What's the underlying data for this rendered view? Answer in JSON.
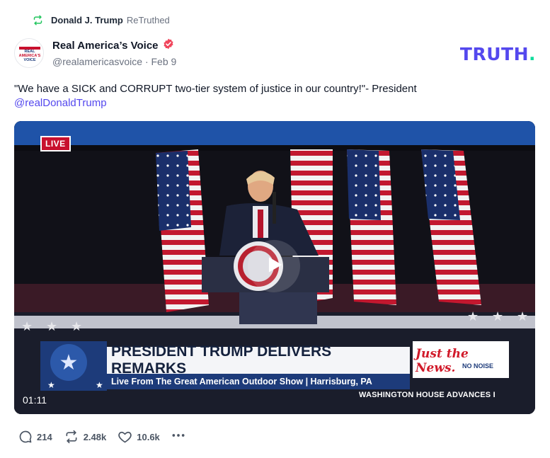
{
  "retruth": {
    "user": "Donald J. Trump",
    "label": "ReTruthed",
    "icon": "retruth-icon"
  },
  "author": {
    "name": "Real America’s Voice",
    "handle": "@realamericasvoice",
    "separator": "·",
    "date": "Feb 9",
    "verified_color": "#f0455b",
    "avatar_text": [
      "REAL",
      "AMERICA'S",
      "VOICE"
    ]
  },
  "brand": {
    "text": "TRUTH",
    "dot": ".",
    "color": "#5448ee",
    "dot_color": "#0fdc9c"
  },
  "post": {
    "text": "\"We have a SICK and CORRUPT two-tier system of justice in our country!\"- President",
    "mention": "@realDonaldTrump"
  },
  "video": {
    "live_badge": "LIVE",
    "headline": "PRESIDENT TRUMP DELIVERS REMARKS",
    "subline": "Live From The Great American Outdoor Show | Harrisburg, PA",
    "logo_main": "Just the News.",
    "logo_sub": "NO NOISE",
    "ticker": "WASHINGTON HOUSE ADVANCES I",
    "duration": "01:11"
  },
  "actions": {
    "replies": "214",
    "retruths": "2.48k",
    "likes": "10.6k"
  }
}
